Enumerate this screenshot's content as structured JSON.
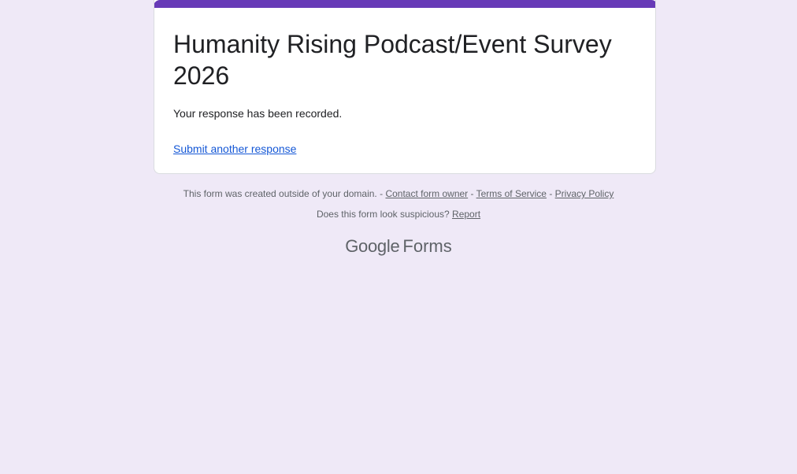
{
  "form": {
    "title": "Humanity Rising Podcast/Event Survey 2026",
    "confirmation_message": "Your response has been recorded.",
    "submit_another_label": "Submit another response"
  },
  "footer": {
    "domain_notice": "This form was created outside of your domain.",
    "separator": " - ",
    "contact_owner_label": "Contact form owner",
    "terms_label": "Terms of Service",
    "privacy_label": "Privacy Policy",
    "suspicious_question": "Does this form look suspicious?",
    "report_label": "Report"
  },
  "brand": {
    "google": "Google",
    "forms": "Forms"
  },
  "colors": {
    "accent": "#673ab7",
    "background": "#efe9f7",
    "link": "#1558d6"
  }
}
